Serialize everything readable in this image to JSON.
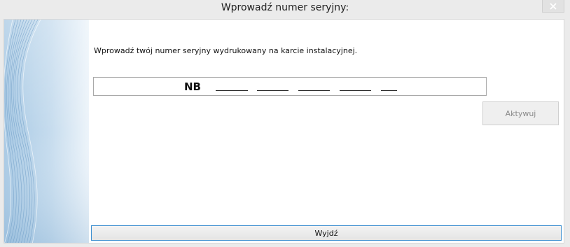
{
  "window": {
    "title": "Wprowadź numer seryjny:"
  },
  "main": {
    "instruction": "Wprowadź twój numer seryjny wydrukowany na karcie instalacyjnej.",
    "serial": {
      "prefix": "NB",
      "segments": [
        "_____",
        "_____",
        "_____",
        "_____",
        "__"
      ]
    },
    "activate_label": "Aktywuj",
    "exit_label": "Wyjdź"
  },
  "colors": {
    "accent": "#3c8fd0",
    "side_gradient_dark": "#9cc2e0",
    "side_gradient_light": "#e8f1f9"
  }
}
